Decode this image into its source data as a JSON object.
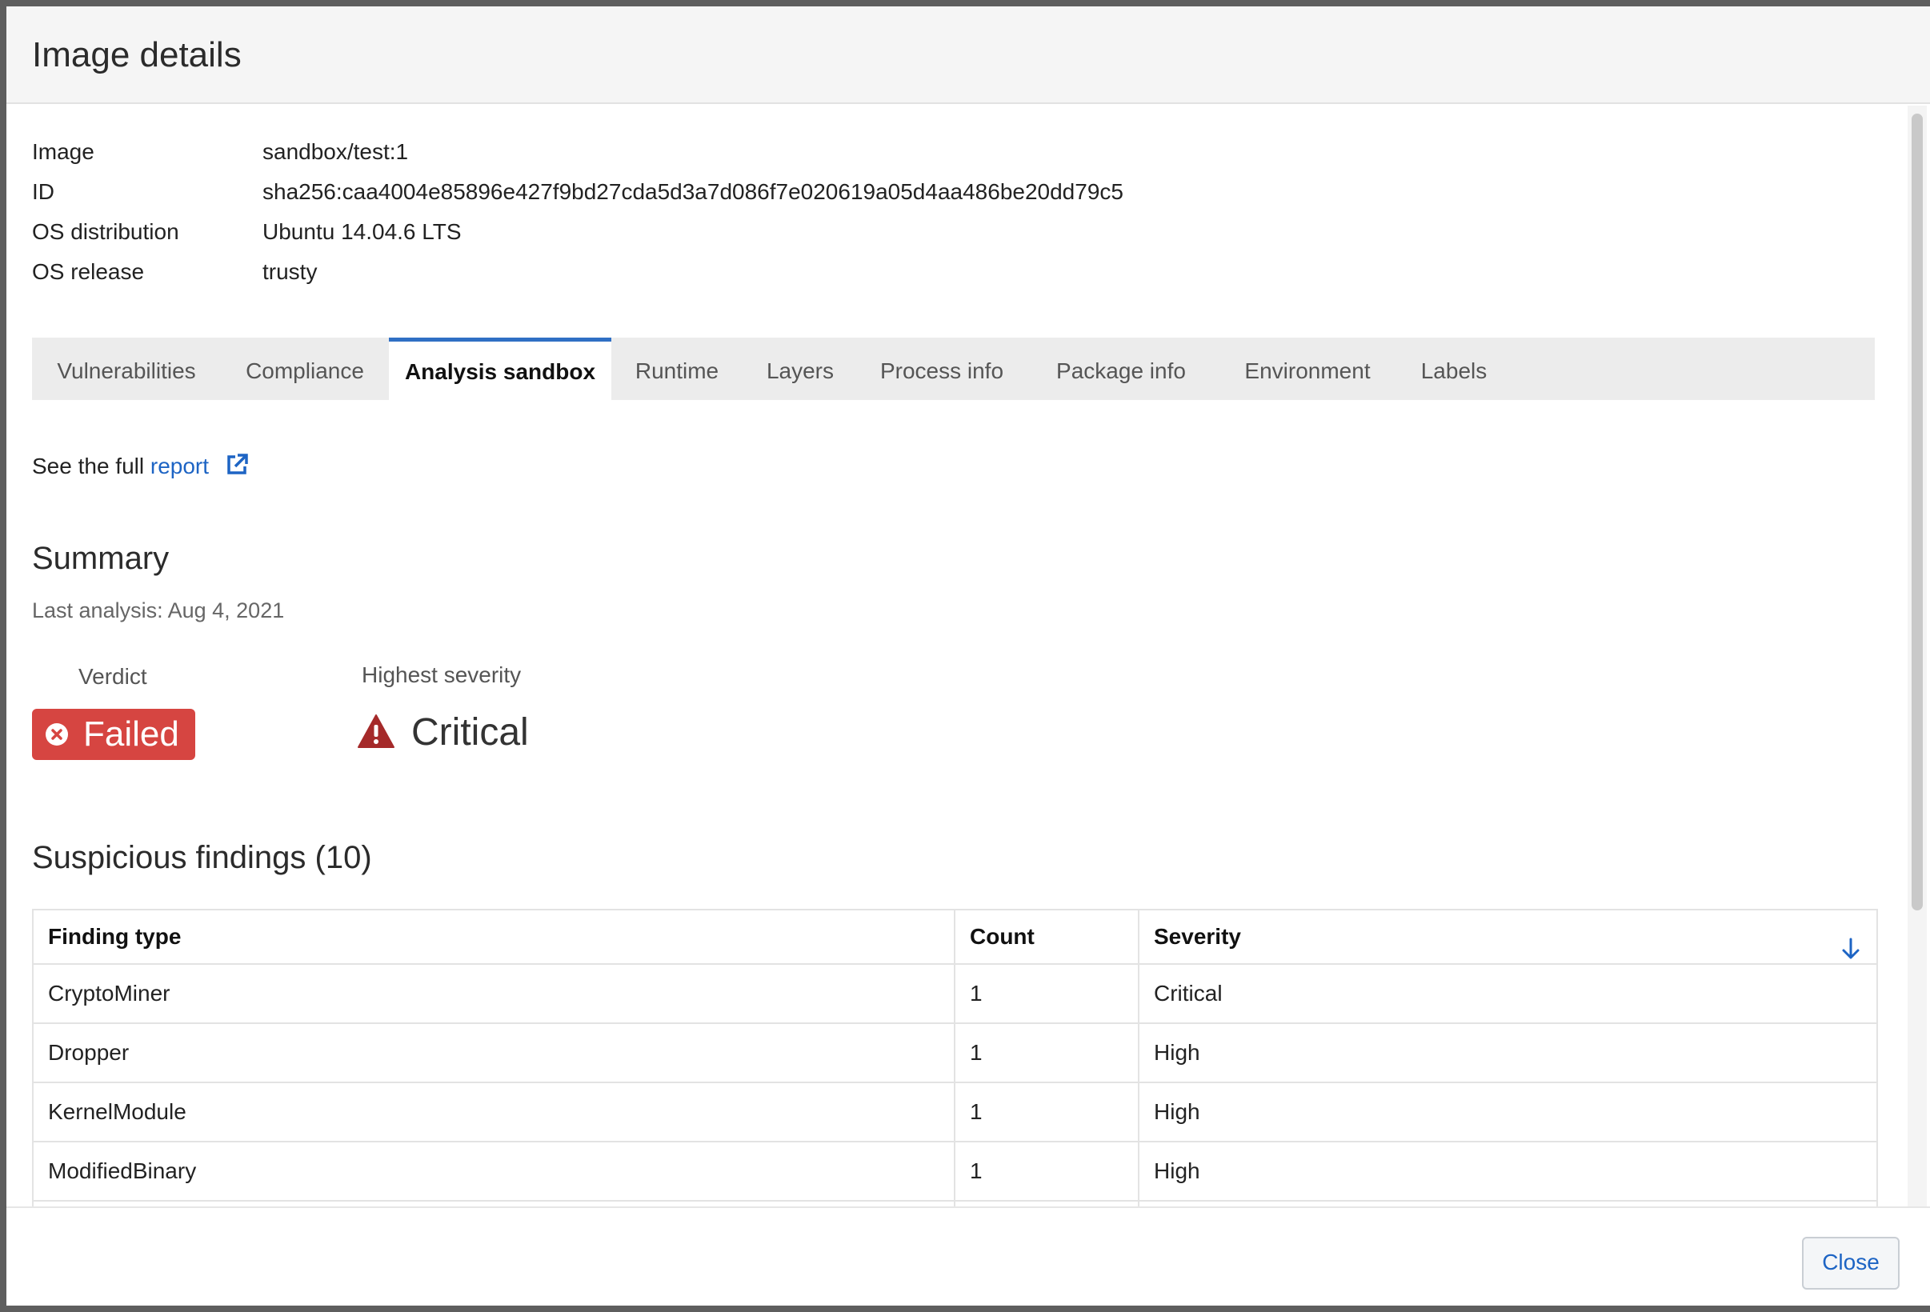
{
  "dialog": {
    "title": "Image details"
  },
  "meta": [
    {
      "label": "Image",
      "value": "sandbox/test:1"
    },
    {
      "label": "ID",
      "value": "sha256:caa4004e85896e427f9bd27cda5d3a7d086f7e020619a05d4aa486be20dd79c5"
    },
    {
      "label": "OS distribution",
      "value": "Ubuntu 14.04.6 LTS"
    },
    {
      "label": "OS release",
      "value": "trusty"
    }
  ],
  "tabs": [
    {
      "label": "Vulnerabilities"
    },
    {
      "label": "Compliance"
    },
    {
      "label": "Analysis sandbox",
      "active": true
    },
    {
      "label": "Runtime"
    },
    {
      "label": "Layers"
    },
    {
      "label": "Process info"
    },
    {
      "label": "Package info"
    },
    {
      "label": "Environment"
    },
    {
      "label": "Labels"
    }
  ],
  "report": {
    "prefix": "See the full",
    "link_text": "report",
    "icon": "external-link-icon"
  },
  "summary": {
    "title": "Summary",
    "last_analysis": "Last analysis: Aug 4, 2021",
    "verdict_label": "Verdict",
    "verdict_value": "Failed",
    "verdict_icon": "x-circle-icon",
    "severity_label": "Highest severity",
    "severity_value": "Critical",
    "severity_icon": "warning-triangle-icon"
  },
  "findings": {
    "title": "Suspicious findings (10)",
    "columns": [
      "Finding type",
      "Count",
      "Severity"
    ],
    "sort_icon": "arrow-down-icon",
    "rows": [
      {
        "type": "CryptoMiner",
        "count": "1",
        "severity": "Critical"
      },
      {
        "type": "Dropper",
        "count": "1",
        "severity": "High"
      },
      {
        "type": "KernelModule",
        "count": "1",
        "severity": "High"
      },
      {
        "type": "ModifiedBinary",
        "count": "1",
        "severity": "High"
      },
      {
        "type": "",
        "count": "",
        "severity": ""
      }
    ]
  },
  "footer": {
    "close_label": "Close"
  },
  "colors": {
    "accent": "#2f6fc4",
    "link": "#1d64c4",
    "failed": "#d64541",
    "critical": "#a52a2a"
  }
}
